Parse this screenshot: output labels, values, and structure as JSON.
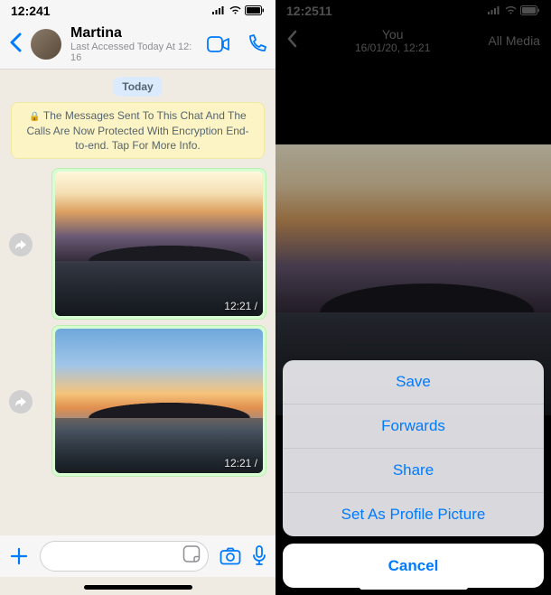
{
  "left": {
    "status_time": "12:241",
    "contact_name": "Martina",
    "last_access": "Last Accessed Today At 12: 16",
    "date_label": "Today",
    "encryption_text": "The Messages Sent To This Chat And The Calls Are Now Protected With Encryption End-to-end. Tap For More Info.",
    "messages": [
      {
        "time": "12:21 /"
      },
      {
        "time": "12:21 /"
      }
    ],
    "input_placeholder": ""
  },
  "right": {
    "status_time": "12:2511",
    "header_sender": "You",
    "header_datetime": "16/01/20, 12:21",
    "header_all_media": "All Media",
    "action_sheet": {
      "save": "Save",
      "forwards": "Forwards",
      "share": "Share",
      "set_profile": "Set As Profile Picture",
      "cancel": "Cancel"
    }
  }
}
